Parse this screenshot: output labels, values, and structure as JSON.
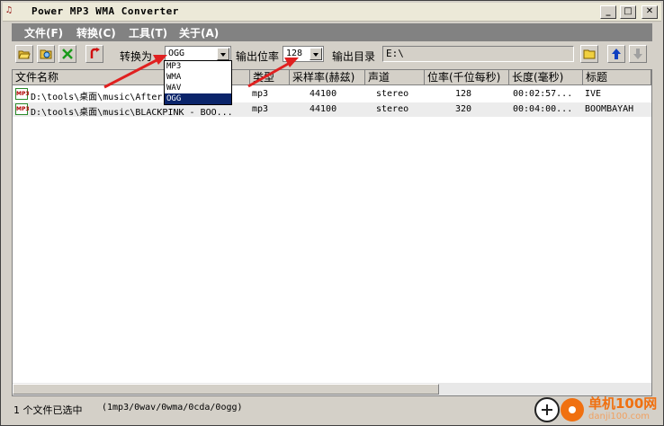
{
  "window": {
    "title": "Power MP3 WMA Converter",
    "icon": "mp3-app-icon"
  },
  "menu": [
    "文件(F)",
    "转换(C)",
    "工具(T)",
    "关于(A)"
  ],
  "toolbar": {
    "convert_label": "转换为",
    "format_value": "OGG",
    "bitrate_label": "输出位率",
    "bitrate_value": "128",
    "outdir_label": "输出目录",
    "outdir_value": "E:\\"
  },
  "format_options": [
    "MP3",
    "WMA",
    "WAV",
    "OGG"
  ],
  "selected_format": "OGG",
  "columns": [
    "文件名称",
    "类型",
    "采样率(赫兹)",
    "声道",
    "位率(千位每秒)",
    "长度(毫秒)",
    "标题"
  ],
  "files": [
    {
      "path": "D:\\tools\\桌面\\music\\After",
      "type": "mp3",
      "rate": "44100",
      "channels": "stereo",
      "bitrate": "128",
      "length": "00:02:57...",
      "title": "IVE"
    },
    {
      "path": "D:\\tools\\桌面\\music\\BLACKPINK - BOO...",
      "type": "mp3",
      "rate": "44100",
      "channels": "stereo",
      "bitrate": "320",
      "length": "00:04:00...",
      "title": "BOOMBAYAH"
    }
  ],
  "status": {
    "selected_text": "1 个文件已选中",
    "formats_text": "(1mp3/0wav/0wma/0cda/0ogg)"
  },
  "watermark": {
    "text": "单机100网",
    "sub": "danji100.com"
  },
  "colors": {
    "arrow": "#e02020",
    "selection": "#0a246a",
    "menubar": "#828282"
  }
}
